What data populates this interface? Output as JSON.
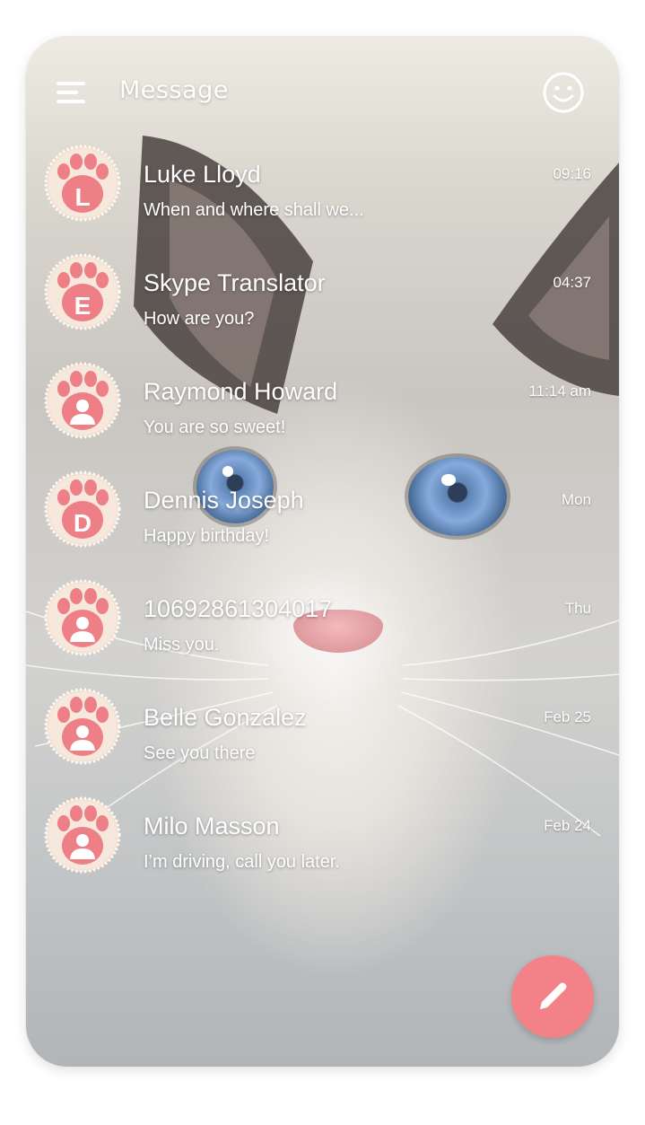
{
  "header": {
    "title": "Message",
    "menu_icon": "hamburger-menu-icon",
    "emoji_icon": "smiley-face-icon"
  },
  "conversations": [
    {
      "name": "Luke Lloyd",
      "preview": "When and where shall we...",
      "time": "09:16",
      "avatar_letter": "L",
      "avatar_icon": "paw-icon"
    },
    {
      "name": "Skype Translator",
      "preview": "How are you?",
      "time": "04:37",
      "avatar_letter": "E",
      "avatar_icon": "paw-icon"
    },
    {
      "name": "Raymond Howard",
      "preview": "You are so sweet!",
      "time": "11:14 am",
      "avatar_letter": "",
      "avatar_icon": "paw-person-icon"
    },
    {
      "name": "Dennis Joseph",
      "preview": "Happy birthday!",
      "time": "Mon",
      "avatar_letter": "D",
      "avatar_icon": "paw-icon"
    },
    {
      "name": "10692861304017",
      "preview": "Miss you.",
      "time": "Thu",
      "avatar_letter": "",
      "avatar_icon": "paw-person-icon"
    },
    {
      "name": "Belle Gonzalez",
      "preview": "See you there",
      "time": "Feb 25",
      "avatar_letter": "",
      "avatar_icon": "paw-person-icon"
    },
    {
      "name": "Milo Masson",
      "preview": "I’m driving, call you later.",
      "time": "Feb 24",
      "avatar_letter": "",
      "avatar_icon": "paw-person-icon"
    }
  ],
  "compose_button": {
    "icon": "pencil-icon"
  },
  "colors": {
    "accent": "#f28288",
    "paw_pad": "#ee7f86",
    "paw_fur": "#f6e3d6",
    "text": "#ffffff"
  }
}
